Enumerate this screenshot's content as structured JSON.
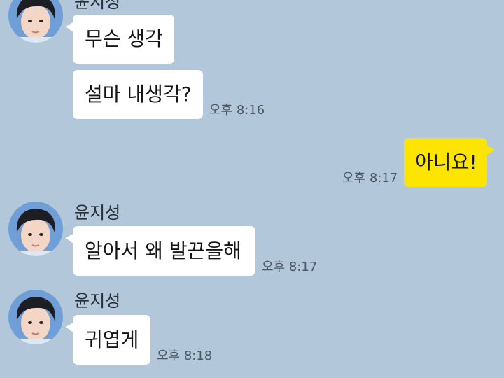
{
  "colors": {
    "background": "#b2c7d9",
    "incoming_bubble": "#ffffff",
    "outgoing_bubble": "#fee500"
  },
  "messages": [
    {
      "sender": "윤지성",
      "avatar_icon": "profile-photo",
      "texts": [
        "무슨 생각",
        "설마 내생각?"
      ],
      "time": "오후 8:16"
    },
    {
      "text": "아니요!",
      "time": "오후 8:17"
    },
    {
      "sender": "윤지성",
      "avatar_icon": "profile-photo",
      "text": "알아서 왜 발끈을해",
      "time": "오후 8:17"
    },
    {
      "sender": "윤지성",
      "avatar_icon": "profile-photo",
      "text": "귀엽게",
      "time": "오후 8:18"
    }
  ]
}
